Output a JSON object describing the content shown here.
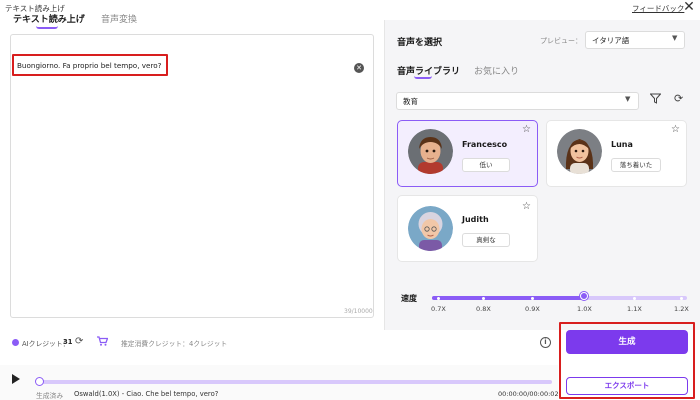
{
  "window": {
    "title": "テキスト読み上げ",
    "feedback": "フィードバック",
    "close": "✕"
  },
  "left": {
    "tabs": [
      {
        "label": "テキスト読み上げ",
        "active": true
      },
      {
        "label": "音声変換",
        "active": false
      }
    ],
    "input_text": "Buongiorno. Fa proprio bel tempo, vero?",
    "char_count": "39/10000"
  },
  "credits": {
    "label": "AIクレジット：",
    "value": "31",
    "estimate": "推定消費クレジット：4クレジット"
  },
  "right": {
    "title": "音声を選択",
    "preview_label": "プレビュー：",
    "language": "イタリア語",
    "tabs": [
      {
        "label": "音声ライブラリ",
        "active": true
      },
      {
        "label": "お気に入り",
        "active": false
      }
    ],
    "category": "教育",
    "voices": [
      {
        "name": "Francesco",
        "tag": "低い",
        "selected": true
      },
      {
        "name": "Luna",
        "tag": "落ち着いた",
        "selected": false
      },
      {
        "name": "Judith",
        "tag": "真剣な",
        "selected": false
      }
    ]
  },
  "speed": {
    "label": "速度",
    "ticks": [
      "0.7X",
      "0.8X",
      "0.9X",
      "1.0X",
      "1.1X",
      "1.2X"
    ],
    "current": "1.0X"
  },
  "actions": {
    "generate": "生成",
    "export": "エクスポート"
  },
  "player": {
    "generated_label": "生成済み",
    "track_info": "Oswald(1.0X) - Ciao. Che bel tempo, vero?",
    "time": "00:00:00/00:00:02",
    "progress": 0
  },
  "colors": {
    "accent": "#7c3aed",
    "highlight": "#d81e1e"
  }
}
